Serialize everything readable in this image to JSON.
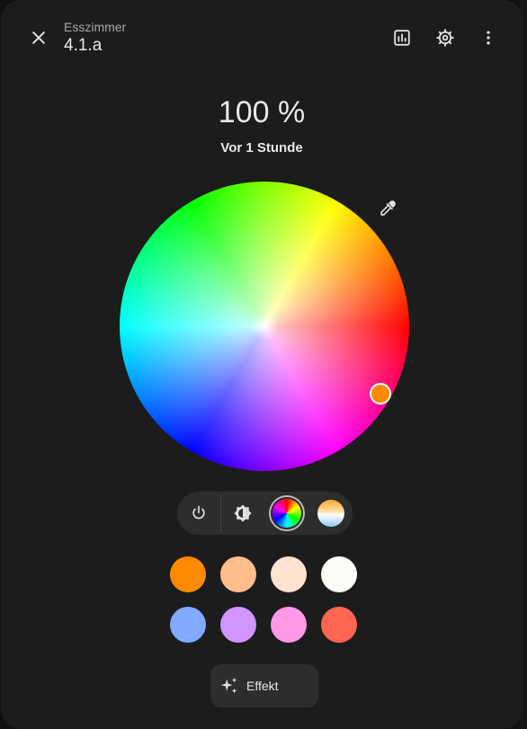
{
  "header": {
    "subtitle": "Esszimmer",
    "title": "4.1.a"
  },
  "state": {
    "brightness": "100 %",
    "last_changed": "Vor 1 Stunde"
  },
  "color_wheel": {
    "selected_color": "#ff8a00"
  },
  "modes": [
    "power-icon",
    "brightness-icon",
    "color-wheel-swatch",
    "color-temp-swatch"
  ],
  "presets": [
    {
      "color": "#ff8a00"
    },
    {
      "color": "#ffbd8c"
    },
    {
      "color": "#ffe2cf"
    },
    {
      "color": "#fdfcf9"
    },
    {
      "color": "#80aaff"
    },
    {
      "color": "#d294ff"
    },
    {
      "color": "#ff98e6"
    },
    {
      "color": "#ff6551"
    }
  ],
  "effect": {
    "label": "Effekt"
  }
}
